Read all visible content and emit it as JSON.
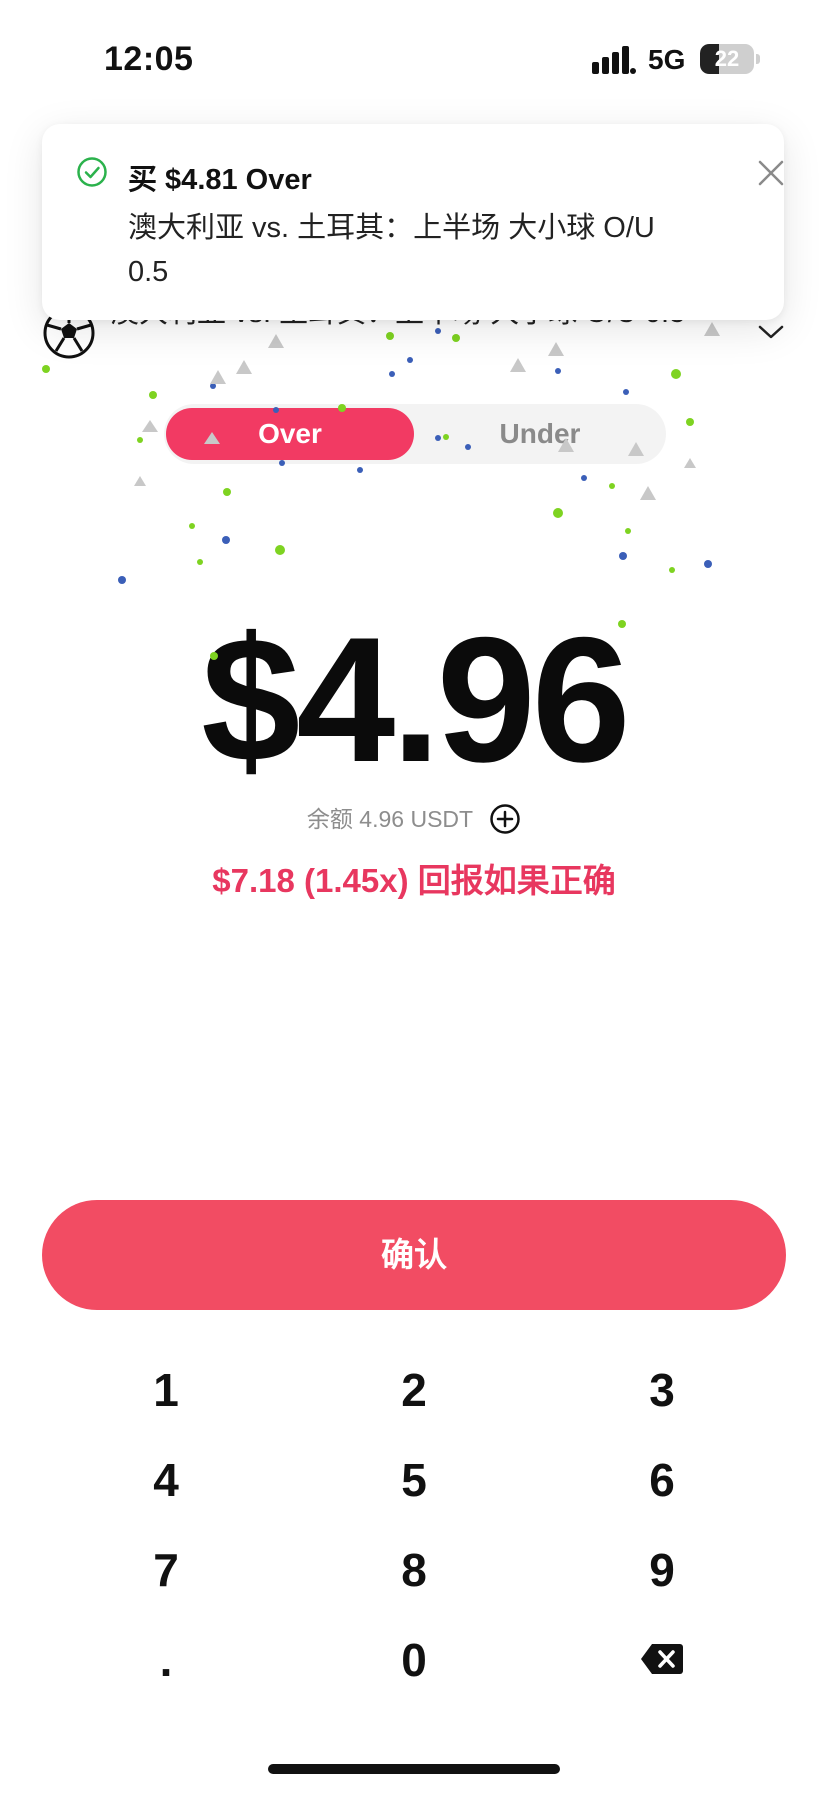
{
  "status_bar": {
    "time": "12:05",
    "network": "5G",
    "battery_level": "22",
    "battery_fraction": 0.22
  },
  "toast": {
    "title": "买 $4.81 Over",
    "description": "澳大利亚 vs. 土耳其：上半场 大小球 O/U 0.5",
    "check_icon": "check-circle-icon",
    "close_icon": "close-icon",
    "check_color": "#2bb24c"
  },
  "market": {
    "title": "澳大利亚 vs. 土耳其：上半场 大小球 O/U 0.5",
    "icon": "soccer-ball-icon"
  },
  "segment": {
    "options": [
      "Over",
      "Under"
    ],
    "selected": "Over",
    "active_color": "#f23a63"
  },
  "amount": {
    "value": "$4.96",
    "balance_text": "余额 4.96 USDT",
    "payout_text": "$7.18 (1.45x) 回报如果正确"
  },
  "confirm": {
    "label": "确认",
    "color": "#f24c63"
  },
  "keypad": {
    "keys": [
      "1",
      "2",
      "3",
      "4",
      "5",
      "6",
      "7",
      "8",
      "9",
      ".",
      "0"
    ],
    "backspace_icon": "backspace-icon"
  }
}
